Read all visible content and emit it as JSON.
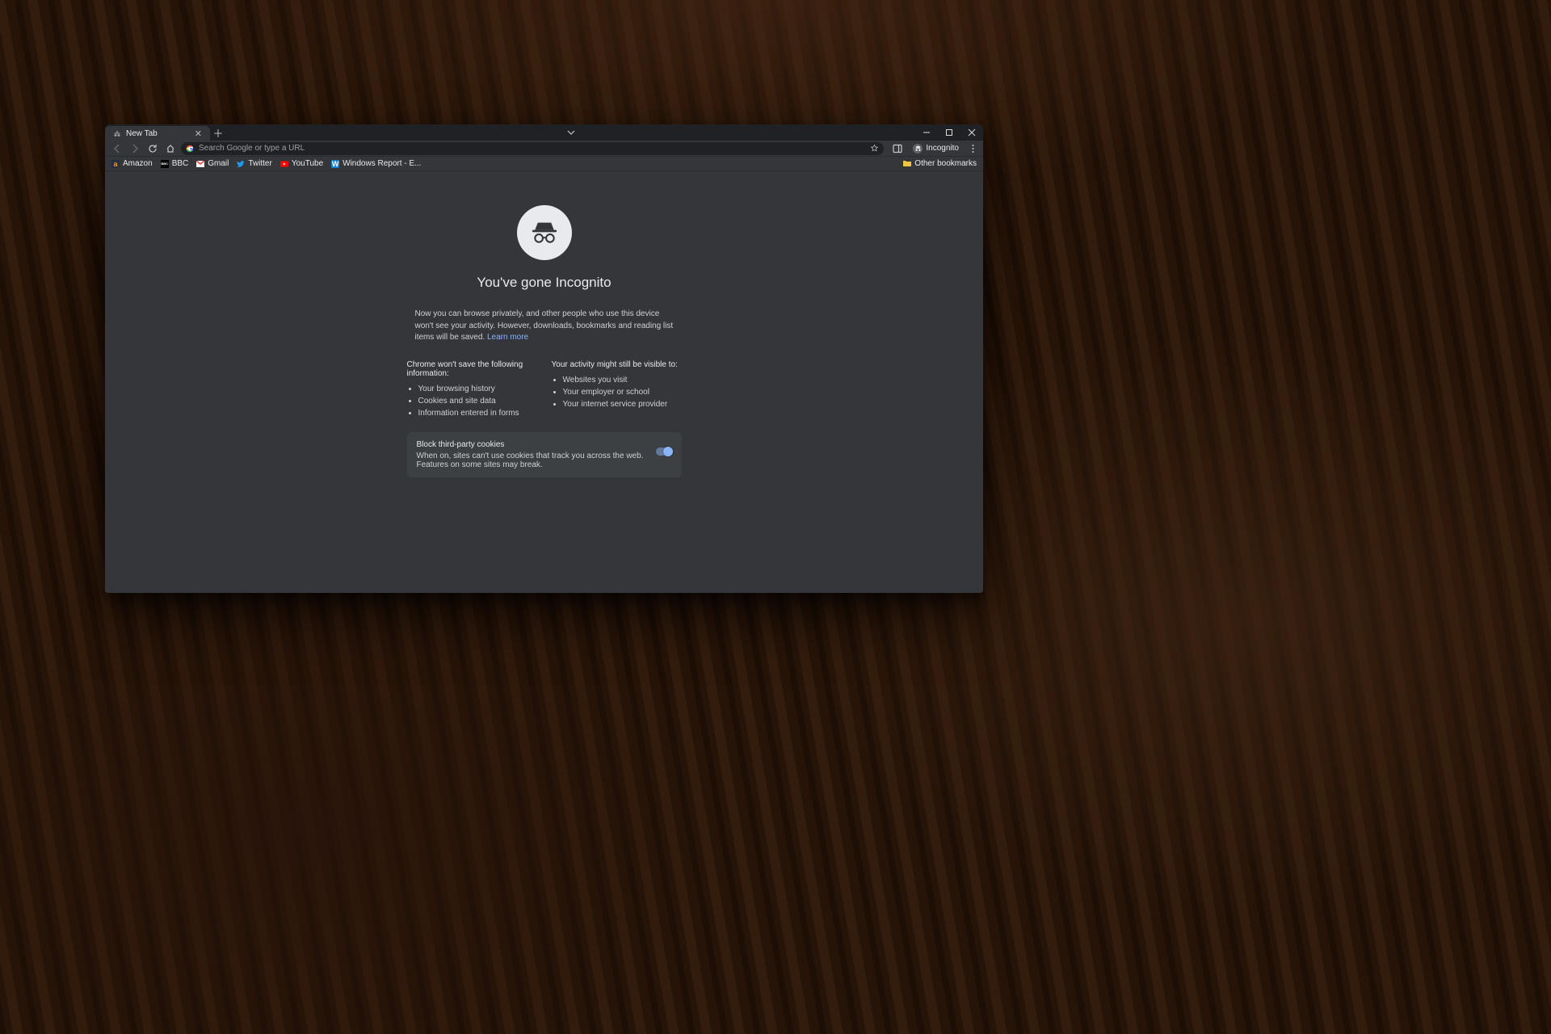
{
  "tab": {
    "title": "New Tab"
  },
  "omnibox": {
    "placeholder": "Search Google or type a URL"
  },
  "profile": {
    "label": "Incognito"
  },
  "bookmarks": {
    "items": [
      {
        "label": "Amazon"
      },
      {
        "label": "BBC"
      },
      {
        "label": "Gmail"
      },
      {
        "label": "Twitter"
      },
      {
        "label": "YouTube"
      },
      {
        "label": "Windows Report - E..."
      }
    ],
    "other_label": "Other bookmarks"
  },
  "hero": {
    "title": "You've gone Incognito",
    "desc": "Now you can browse privately, and other people who use this device won't see your activity. However, downloads, bookmarks and reading list items will be saved.",
    "learn_more": "Learn more",
    "wont_save_heading": "Chrome won't save the following information:",
    "wont_save_items": [
      "Your browsing history",
      "Cookies and site data",
      "Information entered in forms"
    ],
    "visible_heading": "Your activity might still be visible to:",
    "visible_items": [
      "Websites you visit",
      "Your employer or school",
      "Your internet service provider"
    ]
  },
  "cookies": {
    "title": "Block third-party cookies",
    "desc": "When on, sites can't use cookies that track you across the web. Features on some sites may break."
  }
}
